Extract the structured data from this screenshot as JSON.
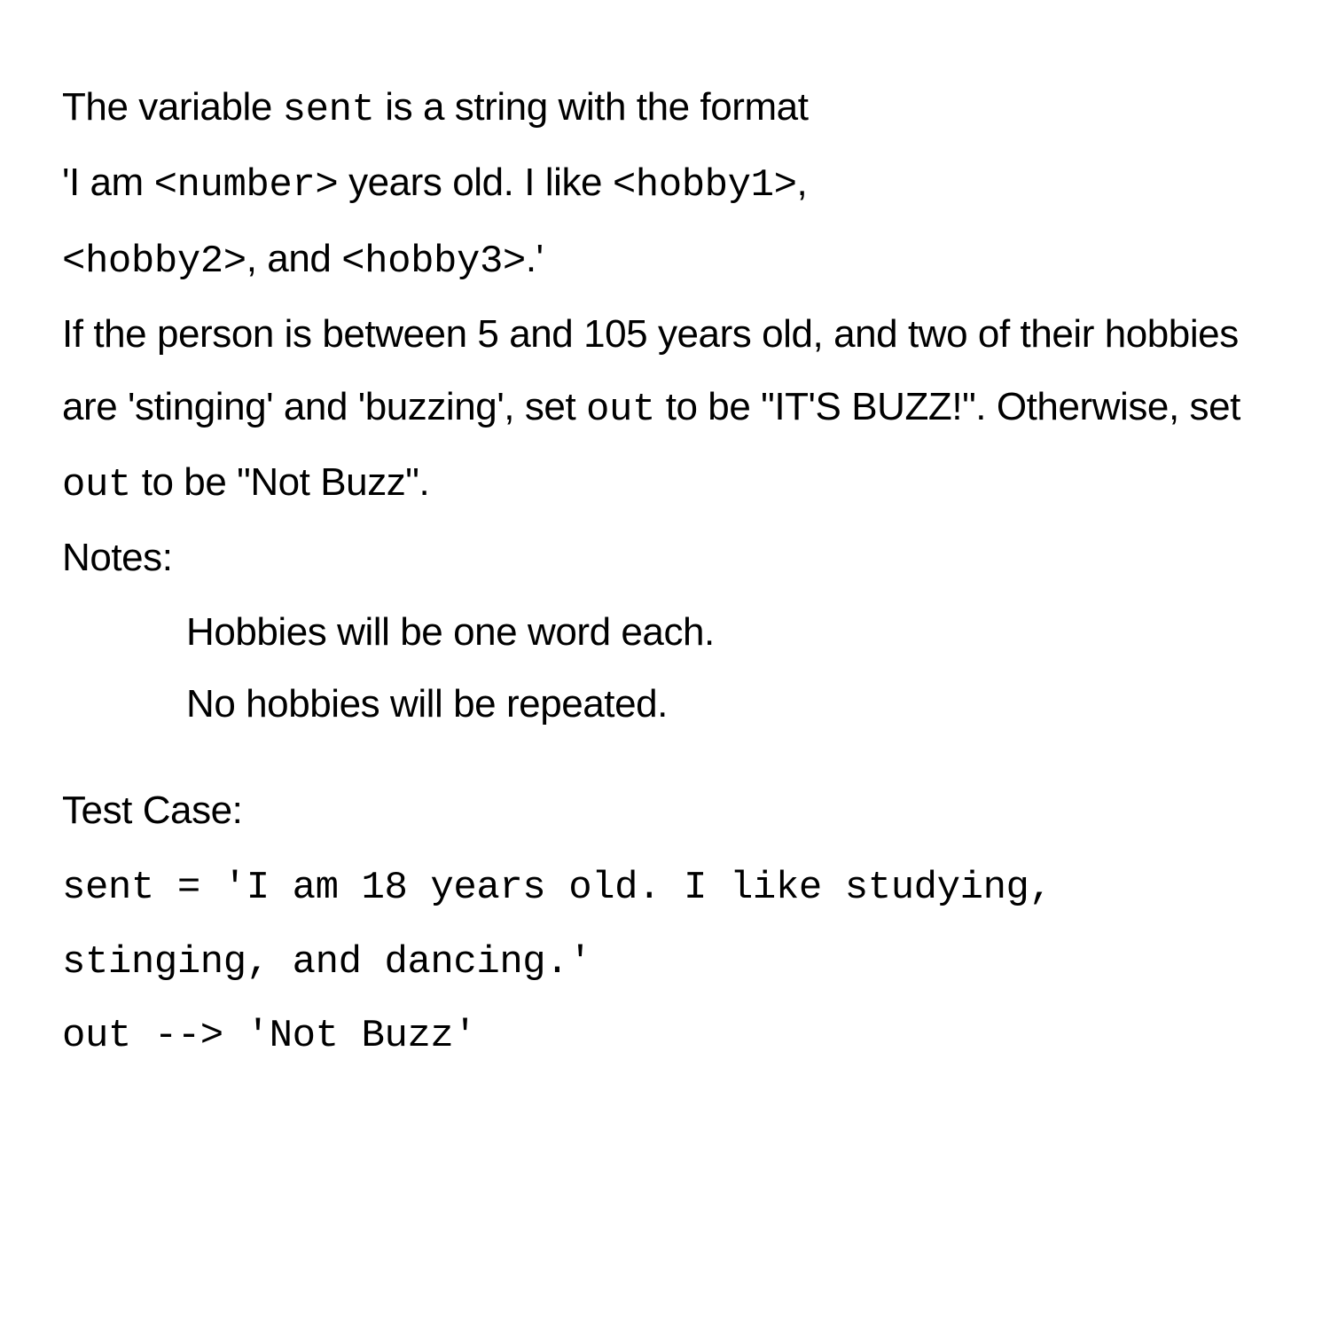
{
  "intro": {
    "part1": "The variable ",
    "code1": "sent",
    "part2": " is a string with the format"
  },
  "format": {
    "part1": "'I am ",
    "code1": "<number>",
    "part2": " years old. I like ",
    "code2": "<hobby1>",
    "part3": ",",
    "code3": "<hobby2>",
    "part4": ", and ",
    "code4": "<hobby3>",
    "part5": ".'"
  },
  "conditions": {
    "line1": "If the person is between 5 and 105 years old, and two of their hobbies are 'stinging' and 'buzzing', set ",
    "code_out1": "out",
    "part2": " to be \"IT'S BUZZ!\". Otherwise, set ",
    "code_out2": "out",
    "part3": " to be \"Not Buzz\"."
  },
  "notes": {
    "heading": "Notes:",
    "items": [
      "Hobbies will be one word each.",
      "No hobbies will be repeated."
    ]
  },
  "test_case": {
    "heading": "Test Case:",
    "line1": "sent = 'I am 18 years old. I like studying, stinging, and dancing.'",
    "line2": "out --> 'Not Buzz'"
  }
}
